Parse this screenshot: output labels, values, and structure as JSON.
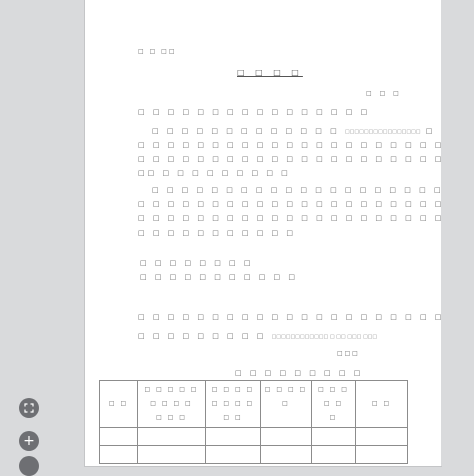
{
  "document": {
    "header_small": "□ □  □□",
    "title": "□ □ □ □",
    "right_mark": "□ □ □",
    "salutation": "□ □ □ □ □ □ □ □ □ □ □ □ □ □ □ □",
    "para1": [
      "□ □ □ □ □ □ □ □ □ □ □ □ □",
      "□ □ □ □ □ □ □ □ □ □ □ □ □ □ □ □ □ □ □ □ □ □ □ □ □ □ □ □ □ □ □ □ □ □ □ □ □",
      "□ □ □ □ □ □ □ □ □ □ □ □ □ □ □ □ □ □ □ □ □ □ □ □ □ □ □ □ □ □ □ □ □ □ □ □ □",
      "□□ □ □ □ □ □ □ □ □ □"
    ],
    "para1_inline_note": "□□□□□□□□□□□□□□□□",
    "para1_tail": "□ □ □ □ □ □ □ □ □ □ □ □ □ □ □ □ □ □ □ □",
    "para2": [
      "□ □ □ □ □ □ □ □ □ □ □ □ □ □ □ □ □ □ □ □ □ □ □ □ □ □ □ □ □ □ □ □ □ □ □",
      "□ □ □ □ □ □ □ □ □ □ □ □ □ □ □ □ □ □ □ □ □ □ □ □ □ □ □ □ □ □ □ □ □ □ □ □ □",
      "□ □ □ □ □ □ □ □ □ □ □ □ □ □ □ □ □ □ □ □ □ □ □ □ □ □ □ □ □ □ □ □ □ □ □ □ □",
      "□ □ □ □ □ □ □ □ □ □ □"
    ],
    "contact_1": "□ □ □ □ □ □ □ □",
    "contact_2": "□ □ □ □ □ □ □ □ □ □ □",
    "footer_line_1": "□ □ □ □ □ □ □ □ □ □ □ □ □ □ □ □ □ □ □ □ □ □ □",
    "footer_line_2": "□ □ □ □ □ □ □ □ □",
    "footer_line_2_note": "□□□□□□□□□□□□  □ □□ □□□ □□□",
    "date_line": "□        □        □",
    "table_caption": "□ □  □ □ □ □ □ □ □",
    "table_headers": [
      "□ □",
      "□ □ □ □ □ □ □ □ □\n□ □ □",
      "□ □ □ □\n□ □ □ □ □ □",
      "□ □ □ □ □",
      "□ □ □ □ □\n□",
      "□ □"
    ]
  },
  "tools": {
    "fit_icon": "fit-screen-icon",
    "zoom_in_label": "+",
    "zoom_in_icon": "plus-icon"
  }
}
